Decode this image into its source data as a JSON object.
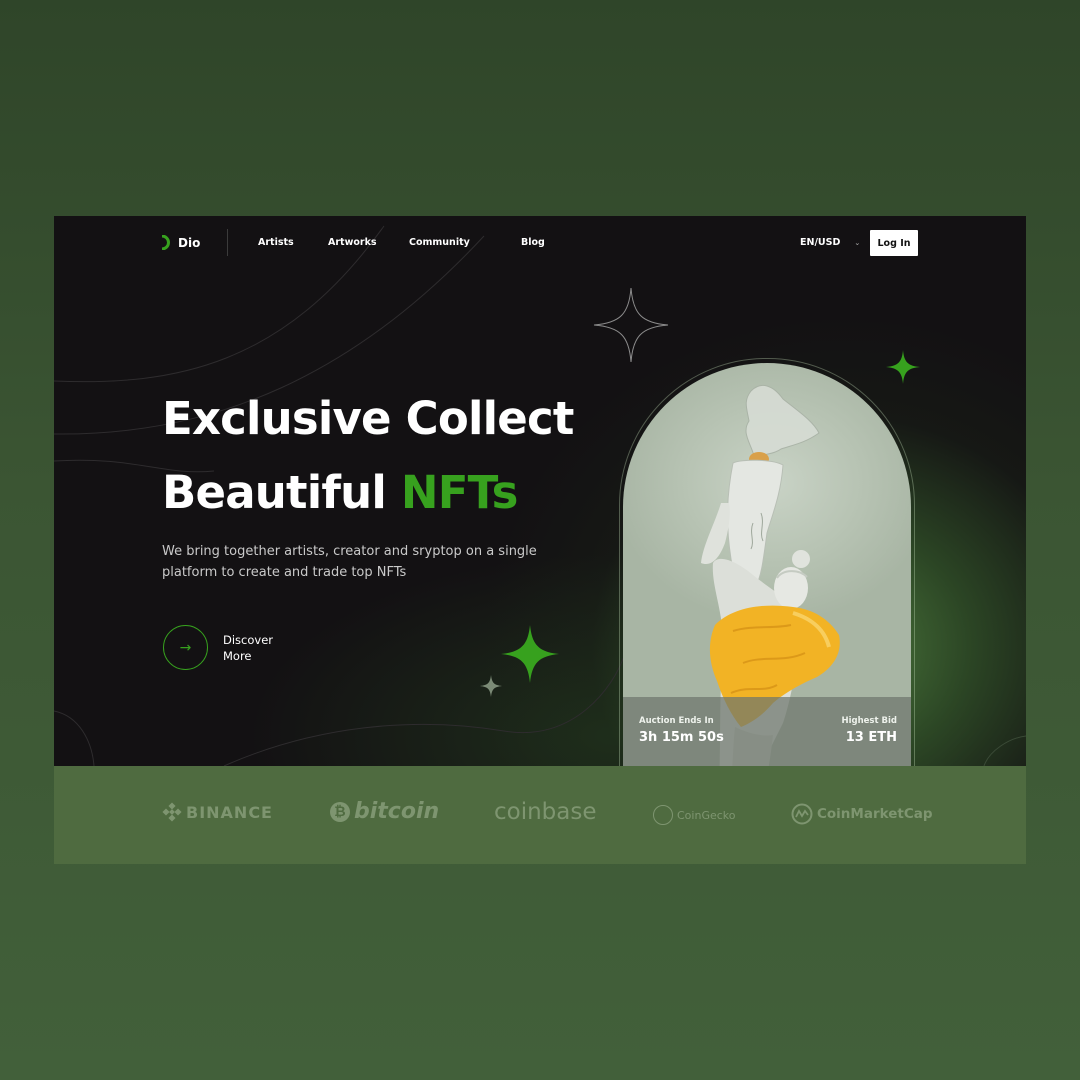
{
  "nav": {
    "brand": "Dio",
    "items": [
      "Artists",
      "Artworks",
      "Community",
      "Blog"
    ],
    "language": "EN/USD",
    "login": "Log In"
  },
  "hero": {
    "headline_line1": "Exclusive Collect",
    "headline_line2_prefix": "Beautiful",
    "headline_line2_accent": "NFTs",
    "subtitle": "We bring together artists, creator and sryptop on a single platform to create and trade top NFTs",
    "cta_line1": "Discover",
    "cta_line2": "More"
  },
  "auction": {
    "ends_label": "Auction Ends In",
    "ends_value": "3h 15m 50s",
    "bid_label": "Highest Bid",
    "bid_value": "13 ETH"
  },
  "partners": [
    "BINANCE",
    "bitcoin",
    "coinbase",
    "CoinGecko",
    "CoinMarketCap"
  ],
  "colors": {
    "accent": "#37a11e",
    "hero_bg": "#131113",
    "partner_bar": "#4f6b40",
    "page_bg": "#3b5533"
  },
  "icons": {
    "cta": "arrow-right-icon",
    "language": "chevron-down-icon",
    "decor": "sparkle-icon"
  }
}
